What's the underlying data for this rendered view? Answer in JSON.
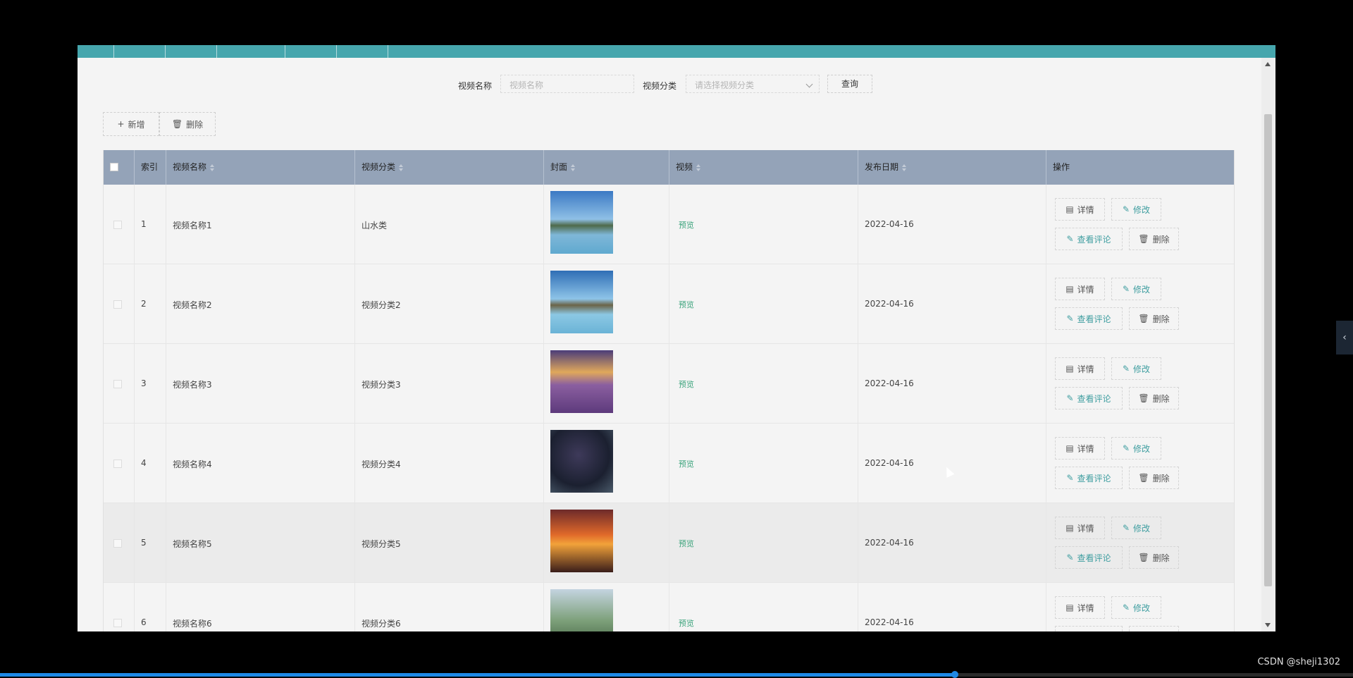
{
  "search": {
    "name_label": "视频名称",
    "name_placeholder": "视频名称",
    "category_label": "视频分类",
    "category_placeholder": "请选择视频分类",
    "query_button": "查询"
  },
  "toolbar": {
    "add_label": "新增",
    "delete_label": "删除"
  },
  "table": {
    "headers": {
      "index": "索引",
      "name": "视频名称",
      "category": "视频分类",
      "cover": "封面",
      "video": "视频",
      "date": "发布日期",
      "ops": "操作"
    },
    "rows": [
      {
        "index": "1",
        "name": "视频名称1",
        "category": "山水类",
        "video": "预览",
        "date": "2022-04-16"
      },
      {
        "index": "2",
        "name": "视频名称2",
        "category": "视频分类2",
        "video": "预览",
        "date": "2022-04-16"
      },
      {
        "index": "3",
        "name": "视频名称3",
        "category": "视频分类3",
        "video": "预览",
        "date": "2022-04-16"
      },
      {
        "index": "4",
        "name": "视频名称4",
        "category": "视频分类4",
        "video": "预览",
        "date": "2022-04-16"
      },
      {
        "index": "5",
        "name": "视频名称5",
        "category": "视频分类5",
        "video": "预览",
        "date": "2022-04-16"
      },
      {
        "index": "6",
        "name": "视频名称6",
        "category": "视频分类6",
        "video": "预览",
        "date": "2022-04-16"
      }
    ],
    "op_labels": {
      "detail": "详情",
      "edit": "修改",
      "comments": "查看评论",
      "delete": "删除"
    }
  },
  "footer": {
    "watermark": "CSDN @sheji1302"
  },
  "colors": {
    "tabbar": "#46a6ad",
    "header": "#94a3b8",
    "preview_link": "#3aa37b",
    "progress": "#1e88e5"
  },
  "player": {
    "progress_fraction": 0.705
  }
}
